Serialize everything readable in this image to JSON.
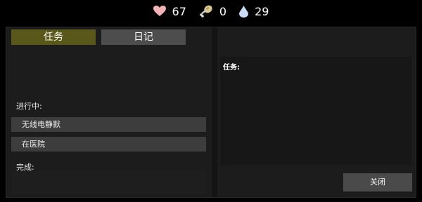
{
  "stats": {
    "health": {
      "icon": "heart-icon",
      "value": "67",
      "color": "#f3b3b6"
    },
    "food": {
      "icon": "drumstick-icon",
      "value": "0",
      "color": "#d9c890"
    },
    "water": {
      "icon": "water-drop-icon",
      "value": "29",
      "color": "#c8dcf5"
    }
  },
  "tabs": [
    {
      "label": "任务",
      "active": true
    },
    {
      "label": "日记",
      "active": false
    }
  ],
  "quests": {
    "in_progress_label": "进行中:",
    "in_progress": [
      {
        "label": "无线电静默"
      },
      {
        "label": "在医院"
      }
    ],
    "completed_label": "完成:"
  },
  "detail": {
    "label": "任务:"
  },
  "close_label": "关闭",
  "colors": {
    "active_tab": "#59581a",
    "inactive_tab": "#4d4d4d",
    "panel": "#1c1c1c",
    "quest_item": "#3d3d3d",
    "button": "#4a4a4a"
  }
}
